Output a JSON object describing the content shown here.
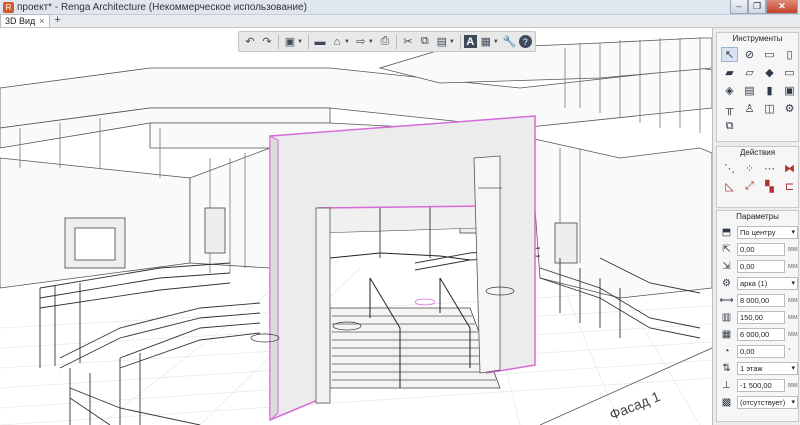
{
  "window": {
    "title": "проект* - Renga Architecture (Некоммерческое использование)",
    "icon": "renga-logo-icon"
  },
  "tabs": [
    {
      "label": "3D Вид"
    }
  ],
  "toolbar": {
    "items": [
      "undo",
      "redo",
      "view-cube",
      "save",
      "print-preview",
      "export",
      "print",
      "cut",
      "copy",
      "paste",
      "text-style",
      "layers",
      "settings",
      "help"
    ]
  },
  "viewport": {
    "facade_label": "Фасад 1",
    "selection_color": "#d86ad8"
  },
  "panels": {
    "tools_title": "Инструменты",
    "actions_title": "Действия",
    "params_title": "Параметры",
    "params": [
      {
        "icon": "alignment-icon",
        "value": "По центру",
        "kind": "select"
      },
      {
        "icon": "offset-x-icon",
        "value": "0,00",
        "unit": "мм"
      },
      {
        "icon": "offset-y-icon",
        "value": "0,00",
        "unit": "мм"
      },
      {
        "icon": "style-icon",
        "value": "арка (1)",
        "kind": "select"
      },
      {
        "icon": "length-icon",
        "value": "8 000,00",
        "unit": "мм"
      },
      {
        "icon": "thickness-icon",
        "value": "150,00",
        "unit": "мм"
      },
      {
        "icon": "height-icon",
        "value": "6 000,00",
        "unit": "мм"
      },
      {
        "icon": "angle-icon",
        "value": "0,00",
        "unit": "°"
      },
      {
        "icon": "level-icon",
        "value": "1 этаж",
        "kind": "select"
      },
      {
        "icon": "elevation-icon",
        "value": "-1 500,00",
        "unit": "мм"
      },
      {
        "icon": "material-icon",
        "value": "(отсутствует)",
        "kind": "select"
      }
    ]
  }
}
